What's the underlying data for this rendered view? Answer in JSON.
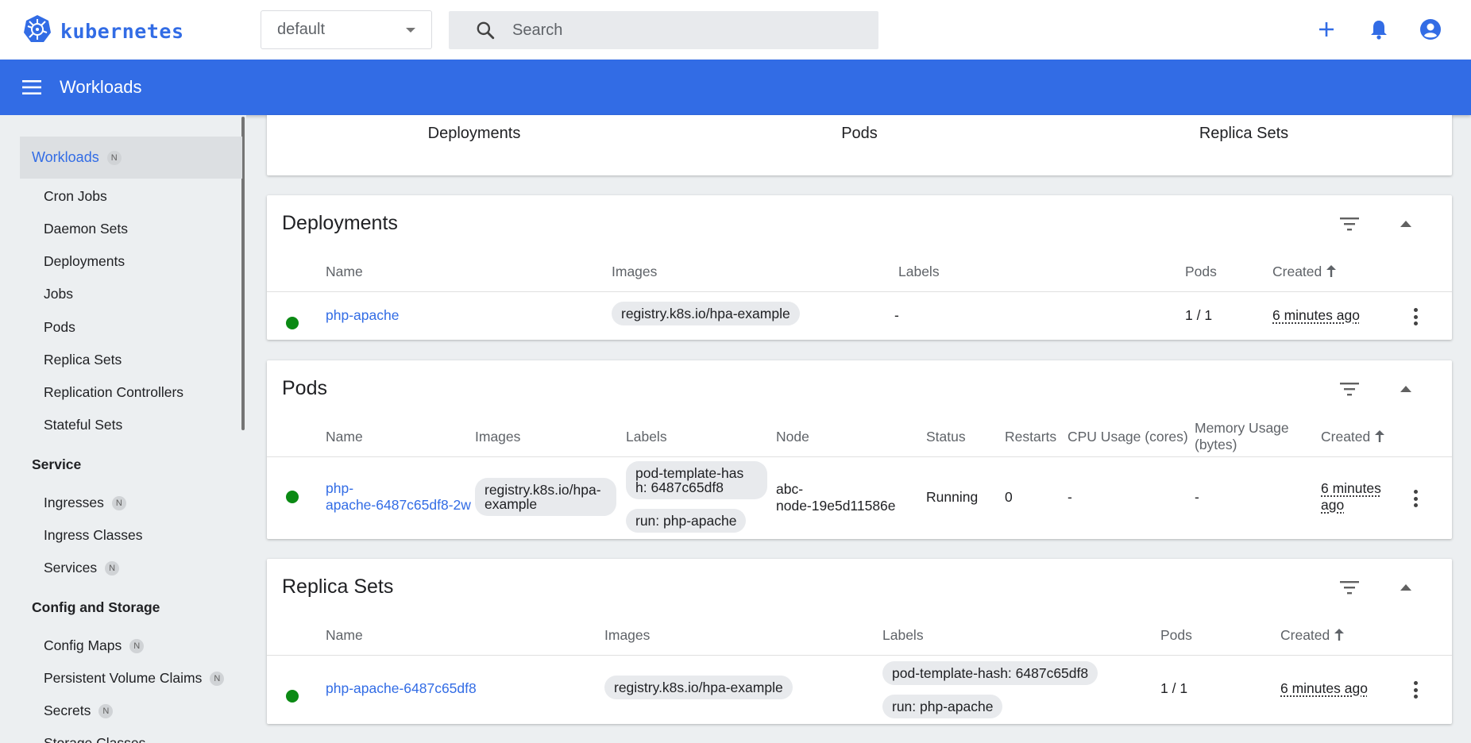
{
  "app": {
    "logo_text": "kubernetes"
  },
  "namespace": {
    "selected": "default"
  },
  "search": {
    "placeholder": "Search"
  },
  "toolbar": {
    "title": "Workloads"
  },
  "sidebar": {
    "active": {
      "label": "Workloads",
      "badge": "N"
    },
    "workloads_items": [
      {
        "label": "Cron Jobs"
      },
      {
        "label": "Daemon Sets"
      },
      {
        "label": "Deployments"
      },
      {
        "label": "Jobs"
      },
      {
        "label": "Pods"
      },
      {
        "label": "Replica Sets"
      },
      {
        "label": "Replication Controllers"
      },
      {
        "label": "Stateful Sets"
      }
    ],
    "service_section": "Service",
    "service_items": [
      {
        "label": "Ingresses",
        "badge": "N"
      },
      {
        "label": "Ingress Classes"
      },
      {
        "label": "Services",
        "badge": "N"
      }
    ],
    "config_section": "Config and Storage",
    "config_items": [
      {
        "label": "Config Maps",
        "badge": "N"
      },
      {
        "label": "Persistent Volume Claims",
        "badge": "N"
      },
      {
        "label": "Secrets",
        "badge": "N"
      },
      {
        "label": "Storage Classes"
      }
    ]
  },
  "tabs": [
    {
      "label": "Deployments"
    },
    {
      "label": "Pods"
    },
    {
      "label": "Replica Sets"
    }
  ],
  "deployments": {
    "title": "Deployments",
    "headers": {
      "name": "Name",
      "images": "Images",
      "labels": "Labels",
      "pods": "Pods",
      "created": "Created"
    },
    "rows": [
      {
        "name": "php-apache",
        "image": "registry.k8s.io/hpa-example",
        "labels": "-",
        "pods": "1 / 1",
        "created": "6 minutes ago",
        "status_color": "#0b8a14"
      }
    ]
  },
  "pods": {
    "title": "Pods",
    "headers": {
      "name": "Name",
      "images": "Images",
      "labels": "Labels",
      "node": "Node",
      "status": "Status",
      "restarts": "Restarts",
      "cpu": "CPU Usage (cores)",
      "memory_line1": "Memory Usage",
      "memory_line2": "(bytes)",
      "created": "Created"
    },
    "rows": [
      {
        "name_line1": "php-",
        "name_line2": "apache-6487c65df8-2w",
        "image_line1": "registry.k8s.io/hpa-",
        "image_line2": "example",
        "label1_line1": "pod-template-has",
        "label1_line2": "h: 6487c65df8",
        "label2": "run: php-apache",
        "node_line1": "abc-",
        "node_line2": "node-19e5d11586e",
        "status": "Running",
        "restarts": "0",
        "cpu": "-",
        "memory": "-",
        "created_line1": "6 minutes",
        "created_line2": "ago",
        "status_color": "#0b8a14"
      }
    ]
  },
  "replica_sets": {
    "title": "Replica Sets",
    "headers": {
      "name": "Name",
      "images": "Images",
      "labels": "Labels",
      "pods": "Pods",
      "created": "Created"
    },
    "rows": [
      {
        "name": "php-apache-6487c65df8",
        "image": "registry.k8s.io/hpa-example",
        "label1": "pod-template-hash: 6487c65df8",
        "label2": "run: php-apache",
        "pods": "1 / 1",
        "created": "6 minutes ago",
        "status_color": "#0b8a14"
      }
    ]
  },
  "colors": {
    "brand": "#326ce5",
    "status_ok": "#0b8a14"
  }
}
